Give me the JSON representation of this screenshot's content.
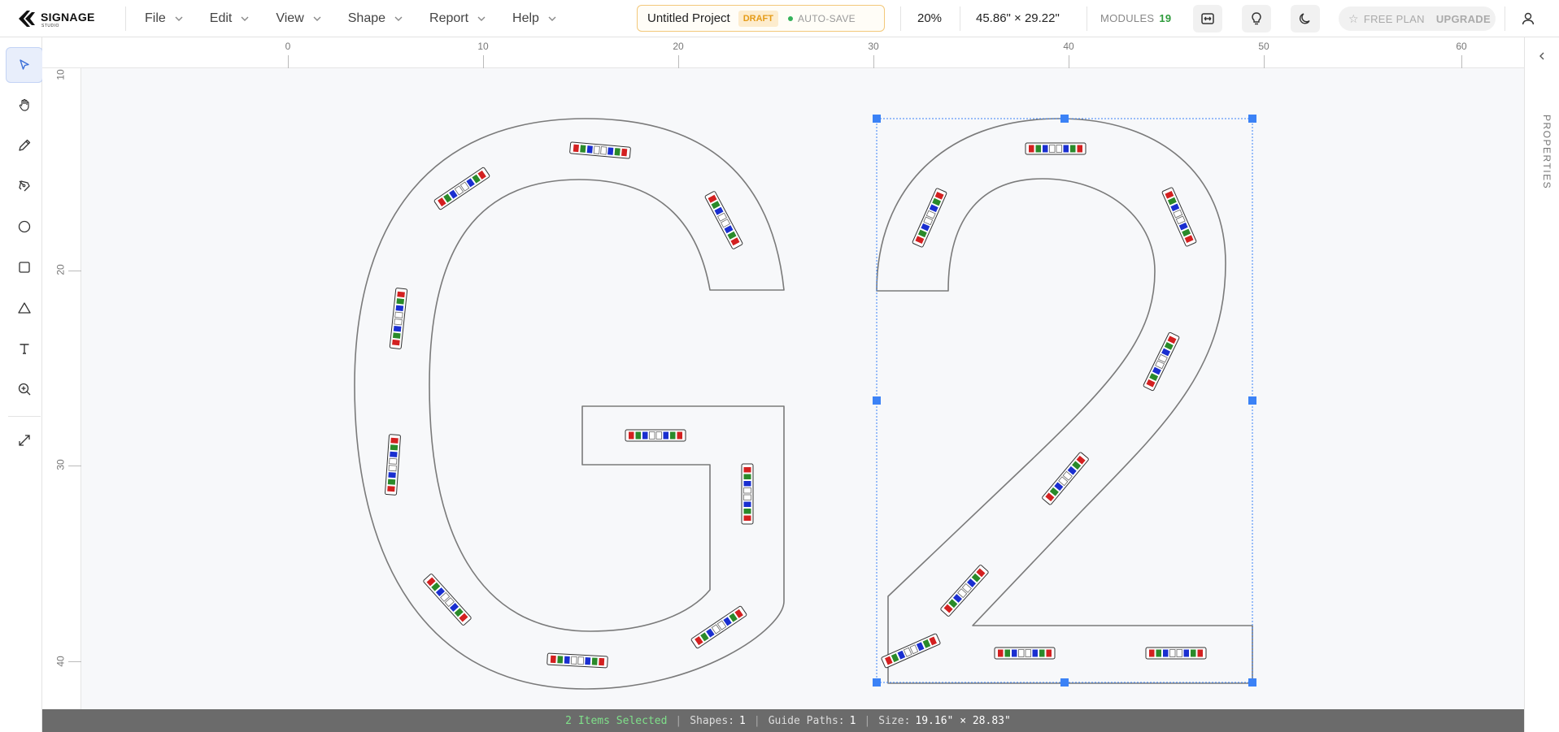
{
  "app": {
    "logo_text": "SIGNAGE",
    "logo_subtext": "STUDIO"
  },
  "menu": [
    {
      "label": "File"
    },
    {
      "label": "Edit"
    },
    {
      "label": "View"
    },
    {
      "label": "Shape"
    },
    {
      "label": "Report"
    },
    {
      "label": "Help"
    }
  ],
  "project": {
    "name": "Untitled Project",
    "status_badge": "DRAFT",
    "autosave_label": "AUTO-SAVE",
    "autosave_color": "#34b25a"
  },
  "view": {
    "zoom": "20%",
    "dimensions": "45.86\" × 29.22\""
  },
  "modules": {
    "label": "MODULES",
    "count": "19"
  },
  "header_icons": [
    "fit-width-icon",
    "lightbulb-icon",
    "moon-icon",
    "user-icon"
  ],
  "plan": {
    "label": "FREE PLAN",
    "upgrade_label": "UPGRADE"
  },
  "tools": [
    {
      "name": "select",
      "icon": "pointer-icon",
      "active": true
    },
    {
      "name": "pan",
      "icon": "hand-icon"
    },
    {
      "name": "pencil",
      "icon": "pencil-icon"
    },
    {
      "name": "pen",
      "icon": "pen-tool-icon"
    },
    {
      "name": "ellipse",
      "icon": "circle-icon"
    },
    {
      "name": "rectangle",
      "icon": "square-icon"
    },
    {
      "name": "triangle",
      "icon": "triangle-icon"
    },
    {
      "name": "text",
      "icon": "text-icon"
    },
    {
      "name": "zoom",
      "icon": "zoom-in-icon"
    },
    {
      "name": "fit",
      "icon": "expand-icon"
    }
  ],
  "ruler": {
    "horizontal": [
      "0",
      "10",
      "20",
      "30",
      "40",
      "50",
      "60"
    ],
    "vertical": [
      "10",
      "20",
      "30",
      "40"
    ]
  },
  "canvas": {
    "selection_color": "#3b82f6",
    "outline_color": "#777777",
    "led_colors": [
      "#d32020",
      "#2a8a2a",
      "#1a2fd0",
      "#ffffff"
    ]
  },
  "properties": {
    "label": "PROPERTIES"
  },
  "status": {
    "selected": "2 Items Selected",
    "shapes_label": "Shapes:",
    "shapes_value": "1",
    "guide_paths_label": "Guide Paths:",
    "guide_paths_value": "1",
    "size_label": "Size:",
    "size_value": "19.16\" × 28.83\""
  }
}
